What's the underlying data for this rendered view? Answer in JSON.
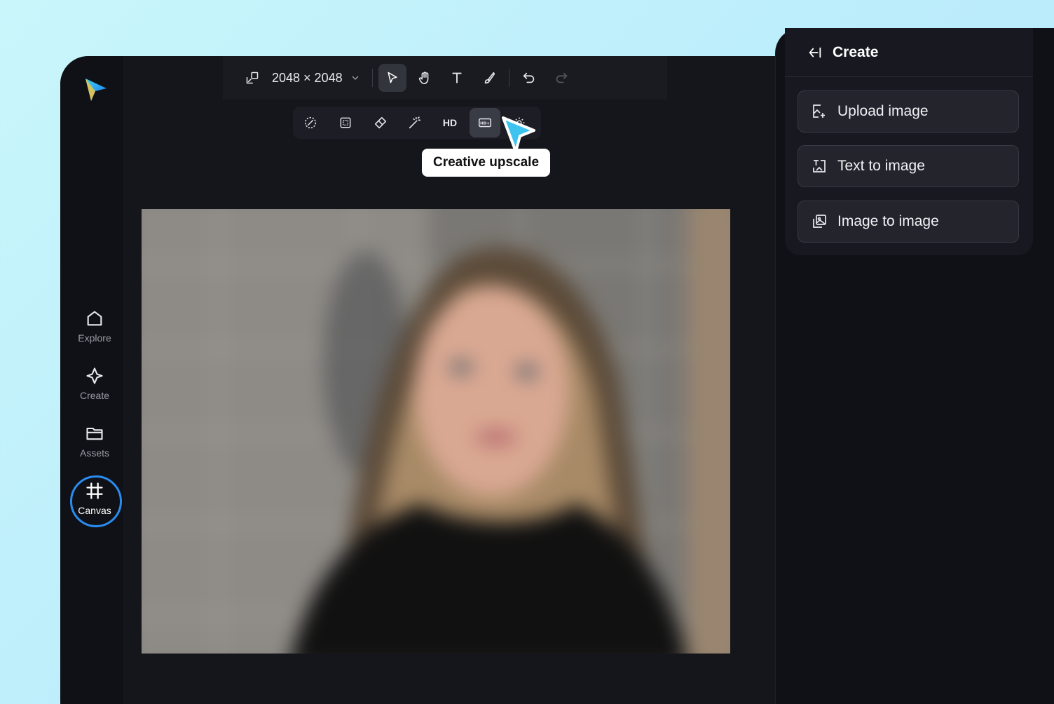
{
  "sidebar": {
    "items": [
      {
        "label": "Explore",
        "icon": "home-icon"
      },
      {
        "label": "Create",
        "icon": "sparkle-icon"
      },
      {
        "label": "Assets",
        "icon": "folder-icon"
      },
      {
        "label": "Canvas",
        "icon": "canvas-icon",
        "active": true
      }
    ]
  },
  "topbar": {
    "size_label": "2048 × 2048",
    "tools": [
      "resize-icon",
      "select-icon",
      "hand-icon",
      "text-icon",
      "brush-icon",
      "undo-icon",
      "redo-icon"
    ]
  },
  "toolbar2": {
    "hd_label": "HD",
    "tools": [
      "remove-background-icon",
      "crop-icon",
      "eraser-icon",
      "magic-wand-icon",
      "hd-icon",
      "creative-upscale-icon",
      "settings-sparkle-icon"
    ]
  },
  "tooltip": {
    "text": "Creative upscale"
  },
  "right_panel": {
    "title": "Create",
    "items": [
      {
        "label": "Upload image",
        "icon": "upload-image-icon"
      },
      {
        "label": "Text to image",
        "icon": "text-to-image-icon"
      },
      {
        "label": "Image to image",
        "icon": "image-to-image-icon"
      }
    ]
  },
  "colors": {
    "accent": "#2a8cf0",
    "cursor": "#3cc3f0",
    "app_bg": "#15161c",
    "panel_bg": "#181920"
  }
}
